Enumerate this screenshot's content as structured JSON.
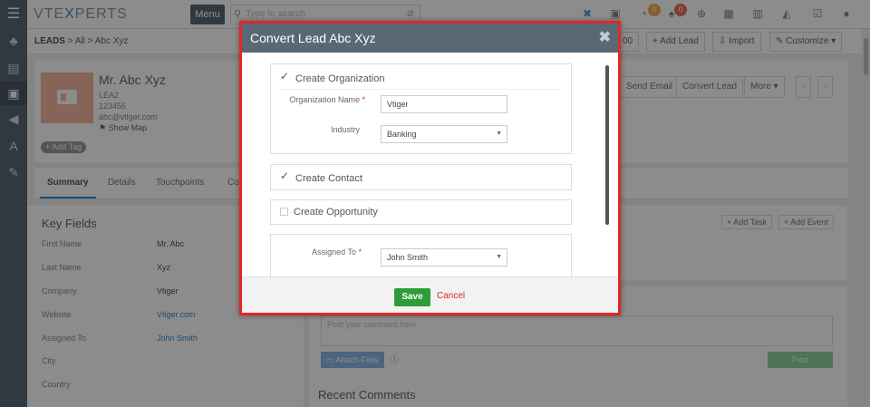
{
  "app": {
    "logo_left": "VTE",
    "logo_x": "X",
    "logo_right": "PERTS",
    "menu_label": "Menu",
    "search_placeholder": "Type to search",
    "badge_comments": "0",
    "badge_notifications": "0"
  },
  "header": {
    "module": "LEADS",
    "breadcrumb_sep1": ">",
    "breadcrumb_all": "All",
    "breadcrumb_sep2": ">",
    "breadcrumb_record": "Abc Xyz",
    "partial_button": "00",
    "add_lead": "+ Add Lead",
    "import": "Import",
    "customize": "Customize"
  },
  "record": {
    "name": "Mr. Abc Xyz",
    "lead_no": "LEA2",
    "phone": "123456",
    "email": "abc@vtiger.com",
    "show_map": "Show Map",
    "add_tag": "+ Add Tag",
    "send_email": "Send Email",
    "convert_lead": "Convert Lead",
    "more": "More"
  },
  "tabs": [
    {
      "label": "Summary"
    },
    {
      "label": "Details"
    },
    {
      "label": "Touchpoints"
    },
    {
      "label": "Co"
    }
  ],
  "key_fields": {
    "title": "Key Fields",
    "rows": [
      {
        "label": "First Name",
        "value": "Mr. Abc"
      },
      {
        "label": "Last Name",
        "value": "Xyz"
      },
      {
        "label": "Company",
        "value": "Vtiger"
      },
      {
        "label": "Website",
        "value": "Vtiger.com"
      },
      {
        "label": "Assigned To",
        "value": "John Smith"
      },
      {
        "label": "City",
        "value": ""
      },
      {
        "label": "Country",
        "value": ""
      }
    ]
  },
  "activities": {
    "add_task": "+ Add Task",
    "add_event": "+ Add Event"
  },
  "comments": {
    "placeholder": "Post your comment here",
    "attach_files": "Attach Files",
    "post": "Post",
    "recent_title": "Recent Comments"
  },
  "modal": {
    "title": "Convert Lead Abc Xyz",
    "create_org": "Create Organization",
    "org_name_label": "Organization Name",
    "org_name_value": "Vtiger",
    "industry_label": "Industry",
    "industry_value": "Banking",
    "create_contact": "Create Contact",
    "create_opportunity": "Create Opportunity",
    "assigned_to_label": "Assigned To",
    "assigned_to_value": "John Smith",
    "required_mark": "*",
    "save": "Save",
    "cancel": "Cancel"
  },
  "colors": {
    "nav": "#596875",
    "accent": "#2d8fd5",
    "save": "#2d9d3a",
    "highlight_border": "#e32626"
  }
}
